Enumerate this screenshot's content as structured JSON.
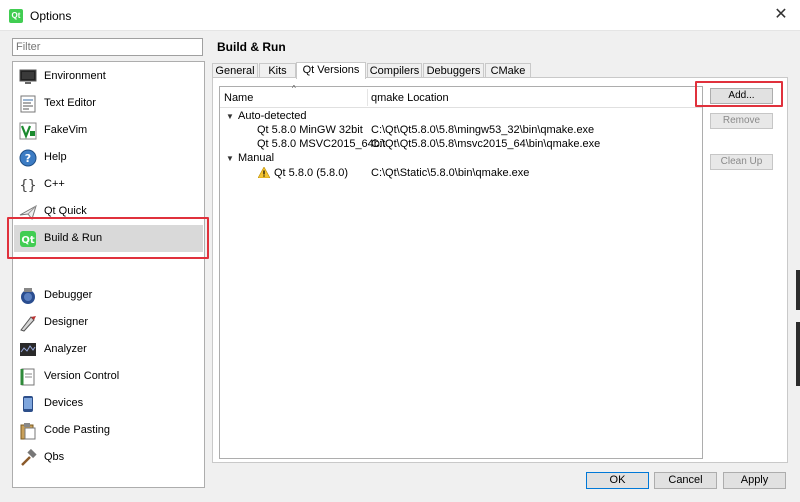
{
  "window": {
    "title": "Options",
    "app_icon_text": "Qt",
    "close_glyph": "✕"
  },
  "filter": {
    "placeholder": "Filter"
  },
  "categories": [
    {
      "label": "Environment",
      "icon": "monitor-icon"
    },
    {
      "label": "Text Editor",
      "icon": "text-editor-icon"
    },
    {
      "label": "FakeVim",
      "icon": "fakevim-icon"
    },
    {
      "label": "Help",
      "icon": "help-icon"
    },
    {
      "label": "C++",
      "icon": "cpp-braces-icon"
    },
    {
      "label": "Qt Quick",
      "icon": "qt-quick-icon"
    },
    {
      "label": "Build & Run",
      "icon": "build-run-icon",
      "selected": true
    },
    {
      "label": "Debugger",
      "icon": "debugger-icon"
    },
    {
      "label": "Designer",
      "icon": "designer-icon"
    },
    {
      "label": "Analyzer",
      "icon": "analyzer-icon"
    },
    {
      "label": "Version Control",
      "icon": "version-control-icon"
    },
    {
      "label": "Devices",
      "icon": "devices-icon"
    },
    {
      "label": "Code Pasting",
      "icon": "code-pasting-icon"
    },
    {
      "label": "Qbs",
      "icon": "qbs-hammer-icon"
    }
  ],
  "page": {
    "title": "Build & Run",
    "tabs": [
      {
        "label": "General"
      },
      {
        "label": "Kits"
      },
      {
        "label": "Qt Versions",
        "active": true
      },
      {
        "label": "Compilers"
      },
      {
        "label": "Debuggers"
      },
      {
        "label": "CMake"
      }
    ]
  },
  "qt_versions": {
    "columns": [
      "Name",
      "qmake Location"
    ],
    "groups": [
      {
        "label": "Auto-detected",
        "items": [
          {
            "name": "Qt 5.8.0 MinGW 32bit",
            "location": "C:\\Qt\\Qt5.8.0\\5.8\\mingw53_32\\bin\\qmake.exe",
            "warning": false
          },
          {
            "name": "Qt 5.8.0 MSVC2015_64bit",
            "location": "C:\\Qt\\Qt5.8.0\\5.8\\msvc2015_64\\bin\\qmake.exe",
            "warning": false
          }
        ]
      },
      {
        "label": "Manual",
        "items": [
          {
            "name": "Qt 5.8.0 (5.8.0)",
            "location": "C:\\Qt\\Static\\5.8.0\\bin\\qmake.exe",
            "warning": true
          }
        ]
      }
    ]
  },
  "side_buttons": {
    "add": "Add...",
    "remove": "Remove",
    "cleanup": "Clean Up"
  },
  "dialog_buttons": {
    "ok": "OK",
    "cancel": "Cancel",
    "apply": "Apply"
  },
  "colors": {
    "highlight_red": "#e0313c",
    "qt_green": "#41cd52",
    "warning_yellow": "#f4c430"
  }
}
